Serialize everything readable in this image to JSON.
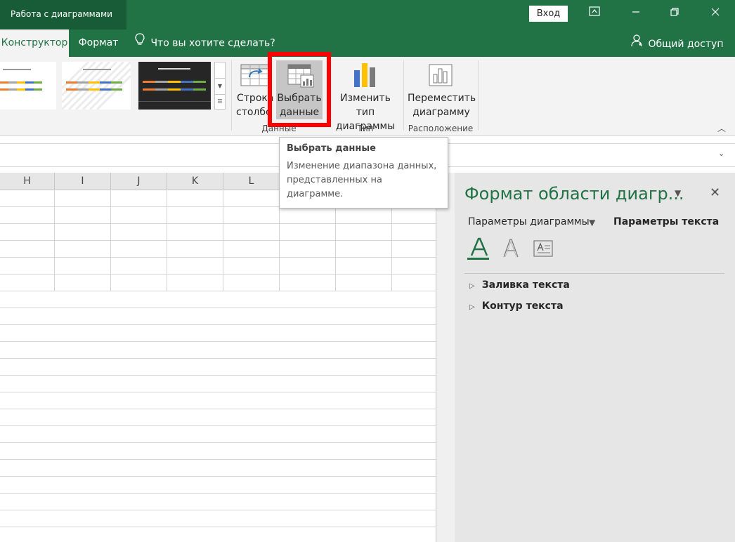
{
  "titlebar": {
    "context_label": "Работа с диаграммами",
    "signin_label": "Вход",
    "ribbon_display_icon": "ribbon-display-icon",
    "minimize_icon": "minimize-icon",
    "restore_icon": "restore-icon",
    "close_icon": "close-icon"
  },
  "tabs": {
    "design": "Конструктор",
    "format": "Формат",
    "tell_me": "Что вы хотите сделать?",
    "share": "Общий доступ"
  },
  "ribbon": {
    "switch_row_col": {
      "line1": "Строка",
      "line2": "столбе"
    },
    "select_data": {
      "line1": "Выбрать",
      "line2": "данные"
    },
    "change_type": {
      "line1": "Изменить тип",
      "line2": "диаграммы"
    },
    "move_chart": {
      "line1": "Переместить",
      "line2": "диаграмму"
    },
    "groups": {
      "data": "Данные",
      "type": "Тип",
      "location": "Расположение"
    },
    "colors": {
      "accent": "#217346",
      "highlight": "#ff0000"
    }
  },
  "tooltip": {
    "title": "Выбрать данные",
    "body": "Изменение диапазона данных, представленных на диаграмме."
  },
  "grid": {
    "columns": [
      "H",
      "I",
      "J",
      "K",
      "L"
    ]
  },
  "pane": {
    "title": "Формат области диагр...",
    "tab_chart_options": "Параметры диаграммы",
    "tab_text_options": "Параметры текста",
    "sections": [
      "Заливка текста",
      "Контур текста"
    ]
  }
}
